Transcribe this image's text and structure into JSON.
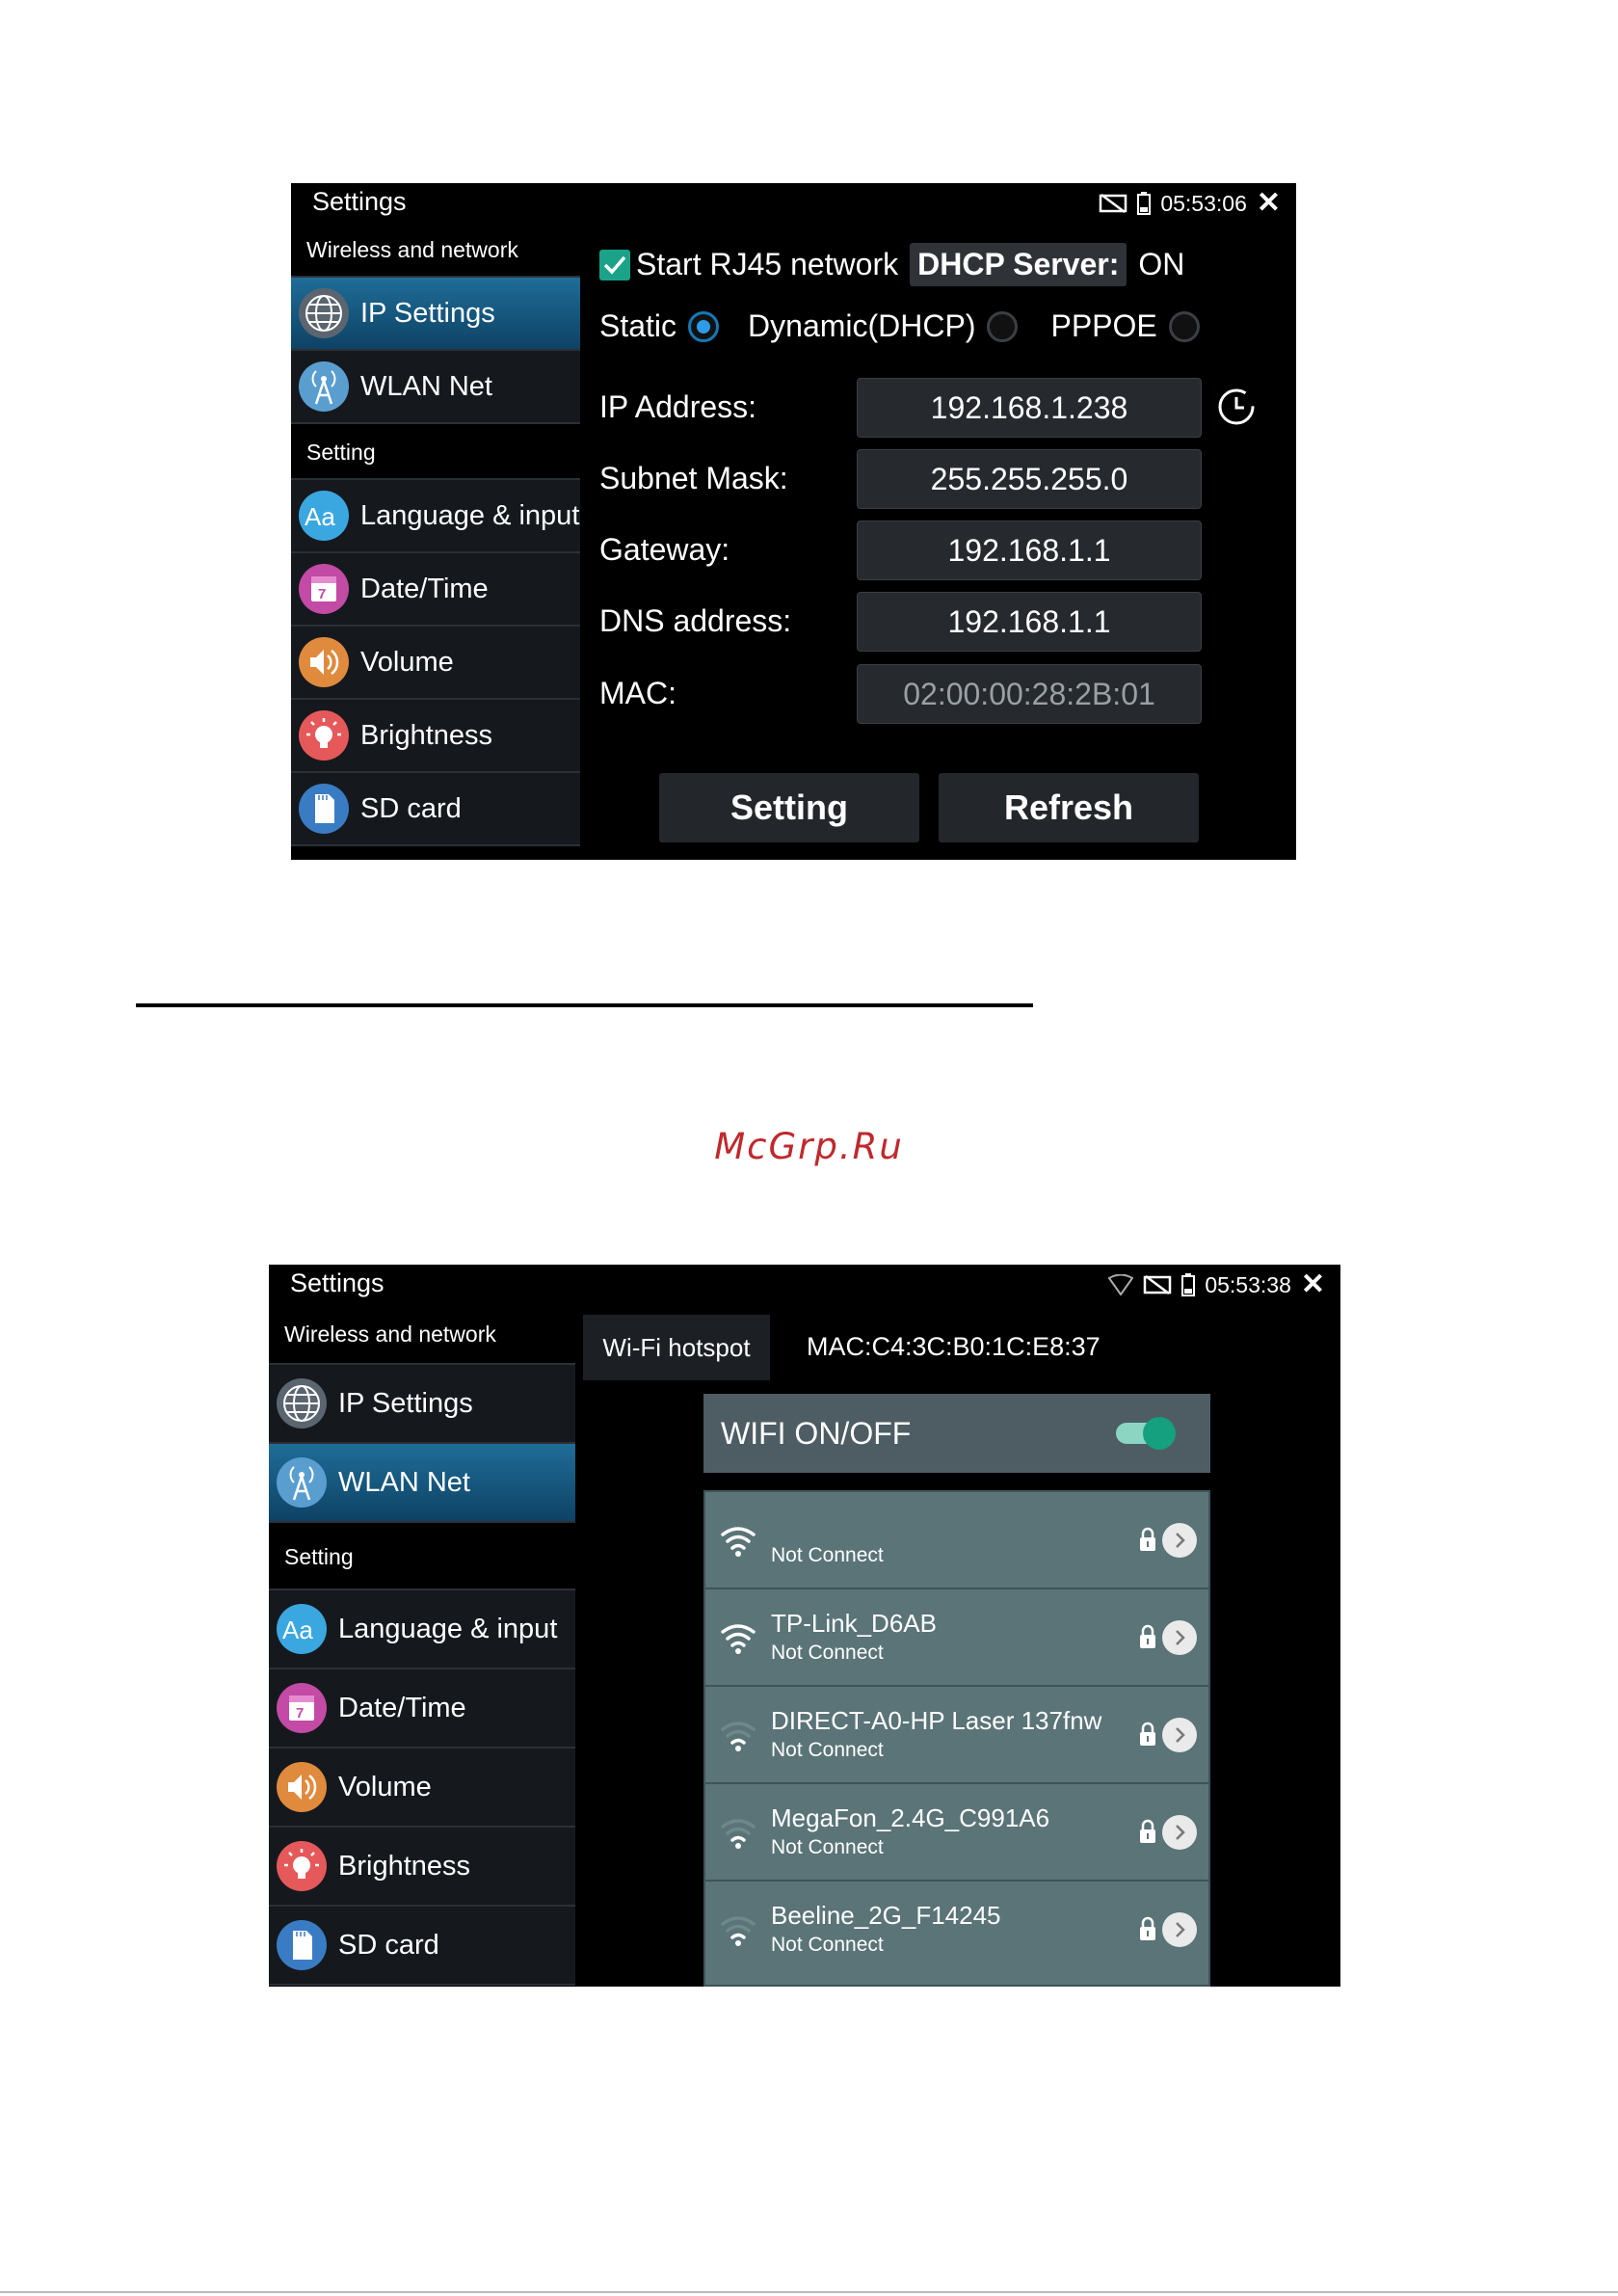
{
  "screen1": {
    "app_title": "Settings",
    "clock": "05:53:06",
    "sidebar": {
      "section1": "Wireless and network",
      "section2": "Setting",
      "items": [
        {
          "label": "IP Settings",
          "icon": "globe-icon",
          "active": true
        },
        {
          "label": "WLAN Net",
          "icon": "antenna-icon",
          "active": false
        },
        {
          "label": "Language & input",
          "icon": "language-icon",
          "active": false
        },
        {
          "label": "Date/Time",
          "icon": "calendar-icon",
          "active": false
        },
        {
          "label": "Volume",
          "icon": "speaker-icon",
          "active": false
        },
        {
          "label": "Brightness",
          "icon": "bulb-icon",
          "active": false
        },
        {
          "label": "SD card",
          "icon": "sdcard-icon",
          "active": false
        }
      ]
    },
    "start_rj45": "Start RJ45 network",
    "dhcp_server_label": "DHCP Server:",
    "dhcp_server_value": "ON",
    "modes": [
      "Static",
      "Dynamic(DHCP)",
      "PPPOE"
    ],
    "selected_mode": "Static",
    "fields": {
      "ip_label": "IP Address:",
      "ip_value": "192.168.1.238",
      "subnet_label": "Subnet Mask:",
      "subnet_value": "255.255.255.0",
      "gateway_label": "Gateway:",
      "gateway_value": "192.168.1.1",
      "dns_label": "DNS address:",
      "dns_value": "192.168.1.1",
      "mac_label": "MAC:",
      "mac_value": "02:00:00:28:2B:01"
    },
    "buttons": {
      "setting": "Setting",
      "refresh": "Refresh"
    }
  },
  "watermark": "McGrp.Ru",
  "screen2": {
    "app_title": "Settings",
    "clock": "05:53:38",
    "sidebar": {
      "section1": "Wireless and network",
      "section2": "Setting",
      "items": [
        {
          "label": "IP Settings",
          "icon": "globe-icon",
          "active": false
        },
        {
          "label": "WLAN Net",
          "icon": "antenna-icon",
          "active": true
        },
        {
          "label": "Language & input",
          "icon": "language-icon",
          "active": false
        },
        {
          "label": "Date/Time",
          "icon": "calendar-icon",
          "active": false
        },
        {
          "label": "Volume",
          "icon": "speaker-icon",
          "active": false
        },
        {
          "label": "Brightness",
          "icon": "bulb-icon",
          "active": false
        },
        {
          "label": "SD card",
          "icon": "sdcard-icon",
          "active": false
        }
      ]
    },
    "hotspot_tab": "Wi-Fi hotspot",
    "mac": "MAC:C4:3C:B0:1C:E8:37",
    "wifi_toggle_label": "WIFI ON/OFF",
    "wifi_on": true,
    "networks": [
      {
        "name": "",
        "status": "Not Connect",
        "signal": "strong"
      },
      {
        "name": "TP-Link_D6AB",
        "status": "Not Connect",
        "signal": "strong"
      },
      {
        "name": "DIRECT-A0-HP Laser 137fnw",
        "status": "Not Connect",
        "signal": "weak"
      },
      {
        "name": "MegaFon_2.4G_C991A6",
        "status": "Not Connect",
        "signal": "weak"
      },
      {
        "name": "Beeline_2G_F14245",
        "status": "Not Connect",
        "signal": "weak"
      }
    ]
  },
  "colors": {
    "accent_blue": "#1f6d98",
    "check_green": "#1aa389",
    "watermark_red": "#c0282c",
    "wifi_panel": "#5a7478"
  }
}
